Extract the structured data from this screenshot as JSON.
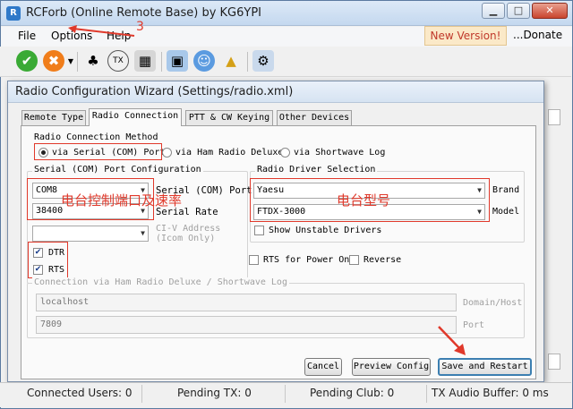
{
  "window": {
    "title": "RCForb (Online Remote Base) by KG6YPI"
  },
  "menu": {
    "file": "File",
    "options": "Options",
    "help": "Help",
    "new_version": "New Version!",
    "donate": "...Donate"
  },
  "annotations": {
    "step3": "3",
    "port_speed": "电台控制端口及速率",
    "radio_model": "电台型号"
  },
  "dialog": {
    "title": "Radio Configuration Wizard (Settings/radio.xml)",
    "tabs": [
      "Remote Type",
      "Radio Connection",
      "PTT & CW Keying",
      "Other Devices"
    ],
    "connection_method": {
      "label": "Radio Connection Method",
      "options": [
        "via Serial (COM) Port",
        "via Ham Radio Deluxe",
        "via Shortwave Log"
      ]
    },
    "serial": {
      "label": "Serial (COM) Port Configuration",
      "port_value": "COM8",
      "port_label": "Serial (COM) Port",
      "rate_value": "38400",
      "rate_label": "Serial Rate",
      "civ_value": "",
      "civ_label_1": "CI-V Address",
      "civ_label_2": "(Icom Only)",
      "dtr": "DTR",
      "rts": "RTS"
    },
    "driver": {
      "label": "Radio Driver Selection",
      "brand_value": "Yaesu",
      "brand_label": "Brand",
      "model_value": "FTDX-3000",
      "model_label": "Model",
      "unstable": "Show Unstable Drivers"
    },
    "rts_power": "RTS for Power On",
    "reverse": "Reverse",
    "hrd": {
      "label": "Connection via Ham Radio Deluxe / Shortwave Log",
      "host_value": "localhost",
      "host_label": "Domain/Host",
      "port_value": "7809",
      "port_label": "Port"
    },
    "buttons": {
      "cancel": "Cancel",
      "preview": "Preview Config",
      "save": "Save and Restart"
    }
  },
  "status": {
    "users": "Connected Users: 0",
    "tx": "Pending TX: 0",
    "club": "Pending Club: 0",
    "audio": "TX Audio Buffer: 0 ms"
  },
  "colors": {
    "annotation": "#e0392b",
    "accent": "#3c7fb1"
  }
}
